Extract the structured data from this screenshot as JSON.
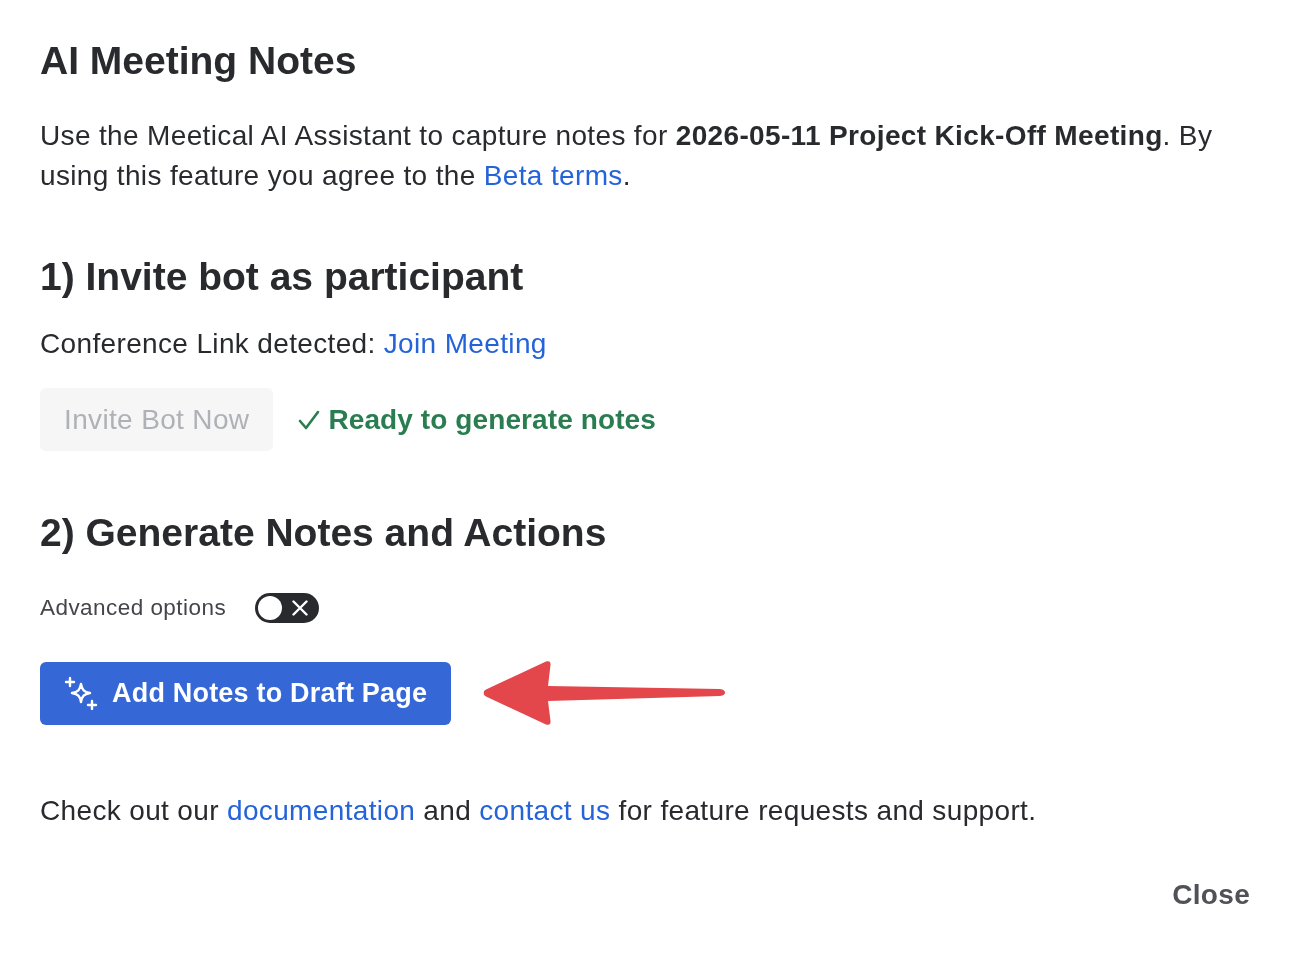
{
  "dialog": {
    "title": "AI Meeting Notes"
  },
  "intro": {
    "parts": [
      {
        "kind": "text",
        "text": "Use the Meetical AI Assistant to capture notes for **2026-05-11 Project Kick-Off Meeting**. By using this feature you agree to the "
      },
      {
        "kind": "link",
        "text": "Beta terms"
      },
      {
        "kind": "text",
        "text": "."
      }
    ]
  },
  "step_1": {
    "heading": "1) Invite bot as participant",
    "conference": {
      "parts": [
        {
          "kind": "text",
          "text": "Conference Link detected: "
        },
        {
          "kind": "link",
          "text": "Join Meeting"
        }
      ]
    },
    "invite_button": {
      "label": "Invite Bot Now",
      "disabled": true
    },
    "status": {
      "label": "Ready to generate notes"
    }
  },
  "step_2": {
    "heading": "2) Generate Notes and Actions",
    "advanced_options": {
      "label": "Advanced options",
      "on": false
    },
    "primary_button": {
      "label": "Add Notes to Draft Page"
    }
  },
  "footer": {
    "parts": [
      {
        "kind": "text",
        "text": "Check out our "
      },
      {
        "kind": "link",
        "text": "documentation"
      },
      {
        "kind": "text",
        "text": " and "
      },
      {
        "kind": "link",
        "text": "contact us"
      },
      {
        "kind": "text",
        "text": " for feature requests and support."
      }
    ]
  },
  "close_button": {
    "label": "Close"
  }
}
